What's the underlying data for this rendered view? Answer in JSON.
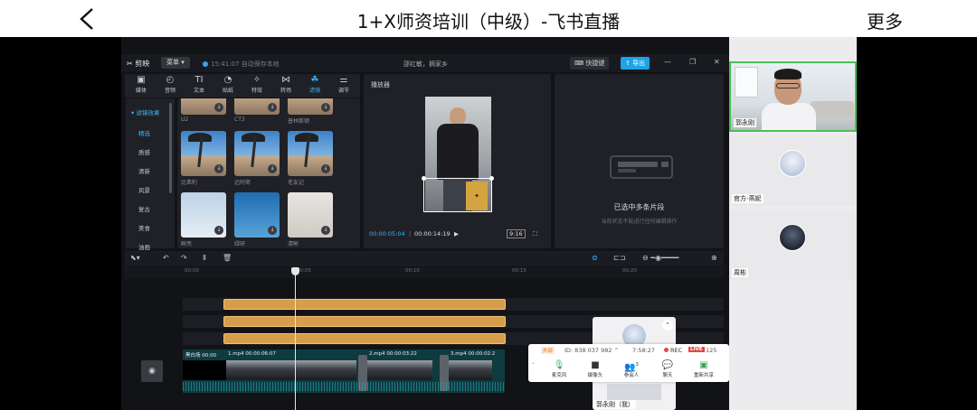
{
  "header": {
    "title": "1+X师资培训（中级）-飞书直播",
    "more_label": "更多"
  },
  "editor": {
    "app_name": "剪映",
    "menu_label": "菜单",
    "autosave_text": "15:41:07 自动保存本地",
    "project_name": "邵红敏，摘家乡",
    "shortcut_label": "快捷键",
    "export_label": "导出",
    "tools": [
      {
        "label": "媒体",
        "icon": "media-icon"
      },
      {
        "label": "音频",
        "icon": "audio-icon"
      },
      {
        "label": "文本",
        "icon": "text-icon"
      },
      {
        "label": "贴纸",
        "icon": "sticker-icon"
      },
      {
        "label": "特效",
        "icon": "effects-icon"
      },
      {
        "label": "转场",
        "icon": "transition-icon"
      },
      {
        "label": "滤镜",
        "icon": "filter-icon",
        "active": true
      },
      {
        "label": "调节",
        "icon": "adjust-icon"
      }
    ],
    "filter_categories": {
      "header": "▾ 滤镜效果",
      "items": [
        "精选",
        "质感",
        "清新",
        "风景",
        "复古",
        "美食",
        "油画"
      ]
    },
    "filters": [
      {
        "label": "U2"
      },
      {
        "label": "CT3"
      },
      {
        "label": "普林斯顿"
      },
      {
        "label": "比弗利"
      },
      {
        "label": "迈阿密"
      },
      {
        "label": "老友记"
      },
      {
        "label": "鲜亮"
      },
      {
        "label": "绿研"
      },
      {
        "label": "清晰"
      }
    ],
    "player": {
      "title": "播放器",
      "current_time": "00:00:05:04",
      "total_time": "00:00:14:19",
      "ratio": "9:16"
    },
    "properties": {
      "title": "已选中多条片段",
      "subtitle": "当前状态不能进行任何编辑操作"
    },
    "timeline": {
      "ticks": [
        "00:00",
        "00:05",
        "00:10",
        "00:15",
        "00:20"
      ],
      "clips": [
        {
          "label": "黑白场",
          "time": "00:00"
        },
        {
          "label": "1.mp4",
          "time": "00:00:06:07"
        },
        {
          "label": "2.mp4",
          "time": "00:00:03:22"
        },
        {
          "label": "3.mp4",
          "time": "00:00:02:2"
        }
      ]
    }
  },
  "meeting": {
    "tag": "外部",
    "meeting_id": "ID: 838 037 982",
    "elapsed": "7:58:27",
    "rec_label": "REC",
    "live_label": "LIVE",
    "viewer_count": "125",
    "participant_badge": "3",
    "controls": [
      {
        "label": "麦克风",
        "icon": "microphone-icon"
      },
      {
        "label": "摄像头",
        "icon": "camera-icon"
      },
      {
        "label": "参会人",
        "icon": "participants-icon"
      },
      {
        "label": "聊天",
        "icon": "chat-icon"
      },
      {
        "label": "重新共享",
        "icon": "share-screen-icon"
      }
    ],
    "self_name": "郭永刚（我）",
    "participants": [
      {
        "name": "郭永刚"
      },
      {
        "name": "官方-燕妮"
      },
      {
        "name": "周彬"
      }
    ]
  },
  "colors": {
    "accent": "#37b3ff",
    "speaker_border": "#4bbf55",
    "clip_orange": "#d69e48",
    "live_red": "#e54545"
  }
}
